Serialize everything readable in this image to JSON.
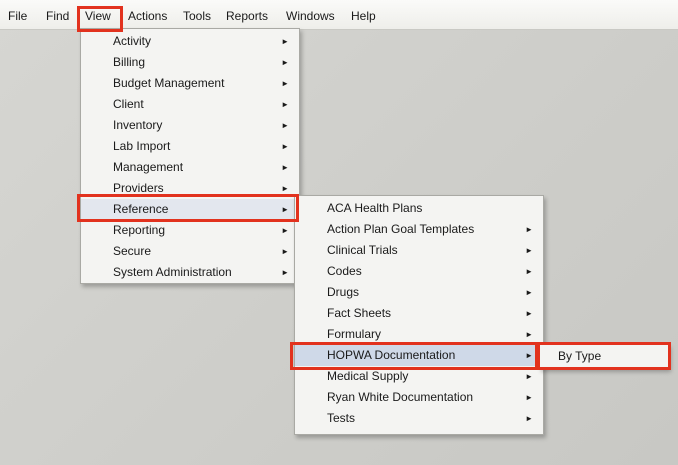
{
  "menubar": {
    "items": [
      "File",
      "Find",
      "View",
      "Actions",
      "Tools",
      "Reports",
      "Windows",
      "Help"
    ]
  },
  "view_menu": {
    "items": [
      {
        "label": "Activity",
        "has_submenu": true
      },
      {
        "label": "Billing",
        "has_submenu": true
      },
      {
        "label": "Budget Management",
        "has_submenu": true
      },
      {
        "label": "Client",
        "has_submenu": true
      },
      {
        "label": "Inventory",
        "has_submenu": true
      },
      {
        "label": "Lab Import",
        "has_submenu": true
      },
      {
        "label": "Management",
        "has_submenu": true
      },
      {
        "label": "Providers",
        "has_submenu": true
      },
      {
        "label": "Reference",
        "has_submenu": true
      },
      {
        "label": "Reporting",
        "has_submenu": true
      },
      {
        "label": "Secure",
        "has_submenu": true
      },
      {
        "label": "System Administration",
        "has_submenu": true
      }
    ],
    "selected": "Reference"
  },
  "reference_menu": {
    "items": [
      {
        "label": "ACA Health Plans",
        "has_submenu": false
      },
      {
        "label": "Action Plan Goal Templates",
        "has_submenu": true
      },
      {
        "label": "Clinical Trials",
        "has_submenu": true
      },
      {
        "label": "Codes",
        "has_submenu": true
      },
      {
        "label": "Drugs",
        "has_submenu": true
      },
      {
        "label": "Fact Sheets",
        "has_submenu": true
      },
      {
        "label": "Formulary",
        "has_submenu": true
      },
      {
        "label": "HOPWA Documentation",
        "has_submenu": true
      },
      {
        "label": "Medical Supply",
        "has_submenu": true
      },
      {
        "label": "Ryan White Documentation",
        "has_submenu": true
      },
      {
        "label": "Tests",
        "has_submenu": true
      }
    ],
    "selected": "HOPWA Documentation"
  },
  "hopwa_menu": {
    "items": [
      {
        "label": "By Type",
        "has_submenu": false
      }
    ]
  },
  "icons": {
    "submenu_arrow": "triangle-right-icon"
  },
  "colors": {
    "highlight_box": "#e2321e",
    "menu_background": "#f4f4f2",
    "desktop_background": "#d2d2ce"
  }
}
